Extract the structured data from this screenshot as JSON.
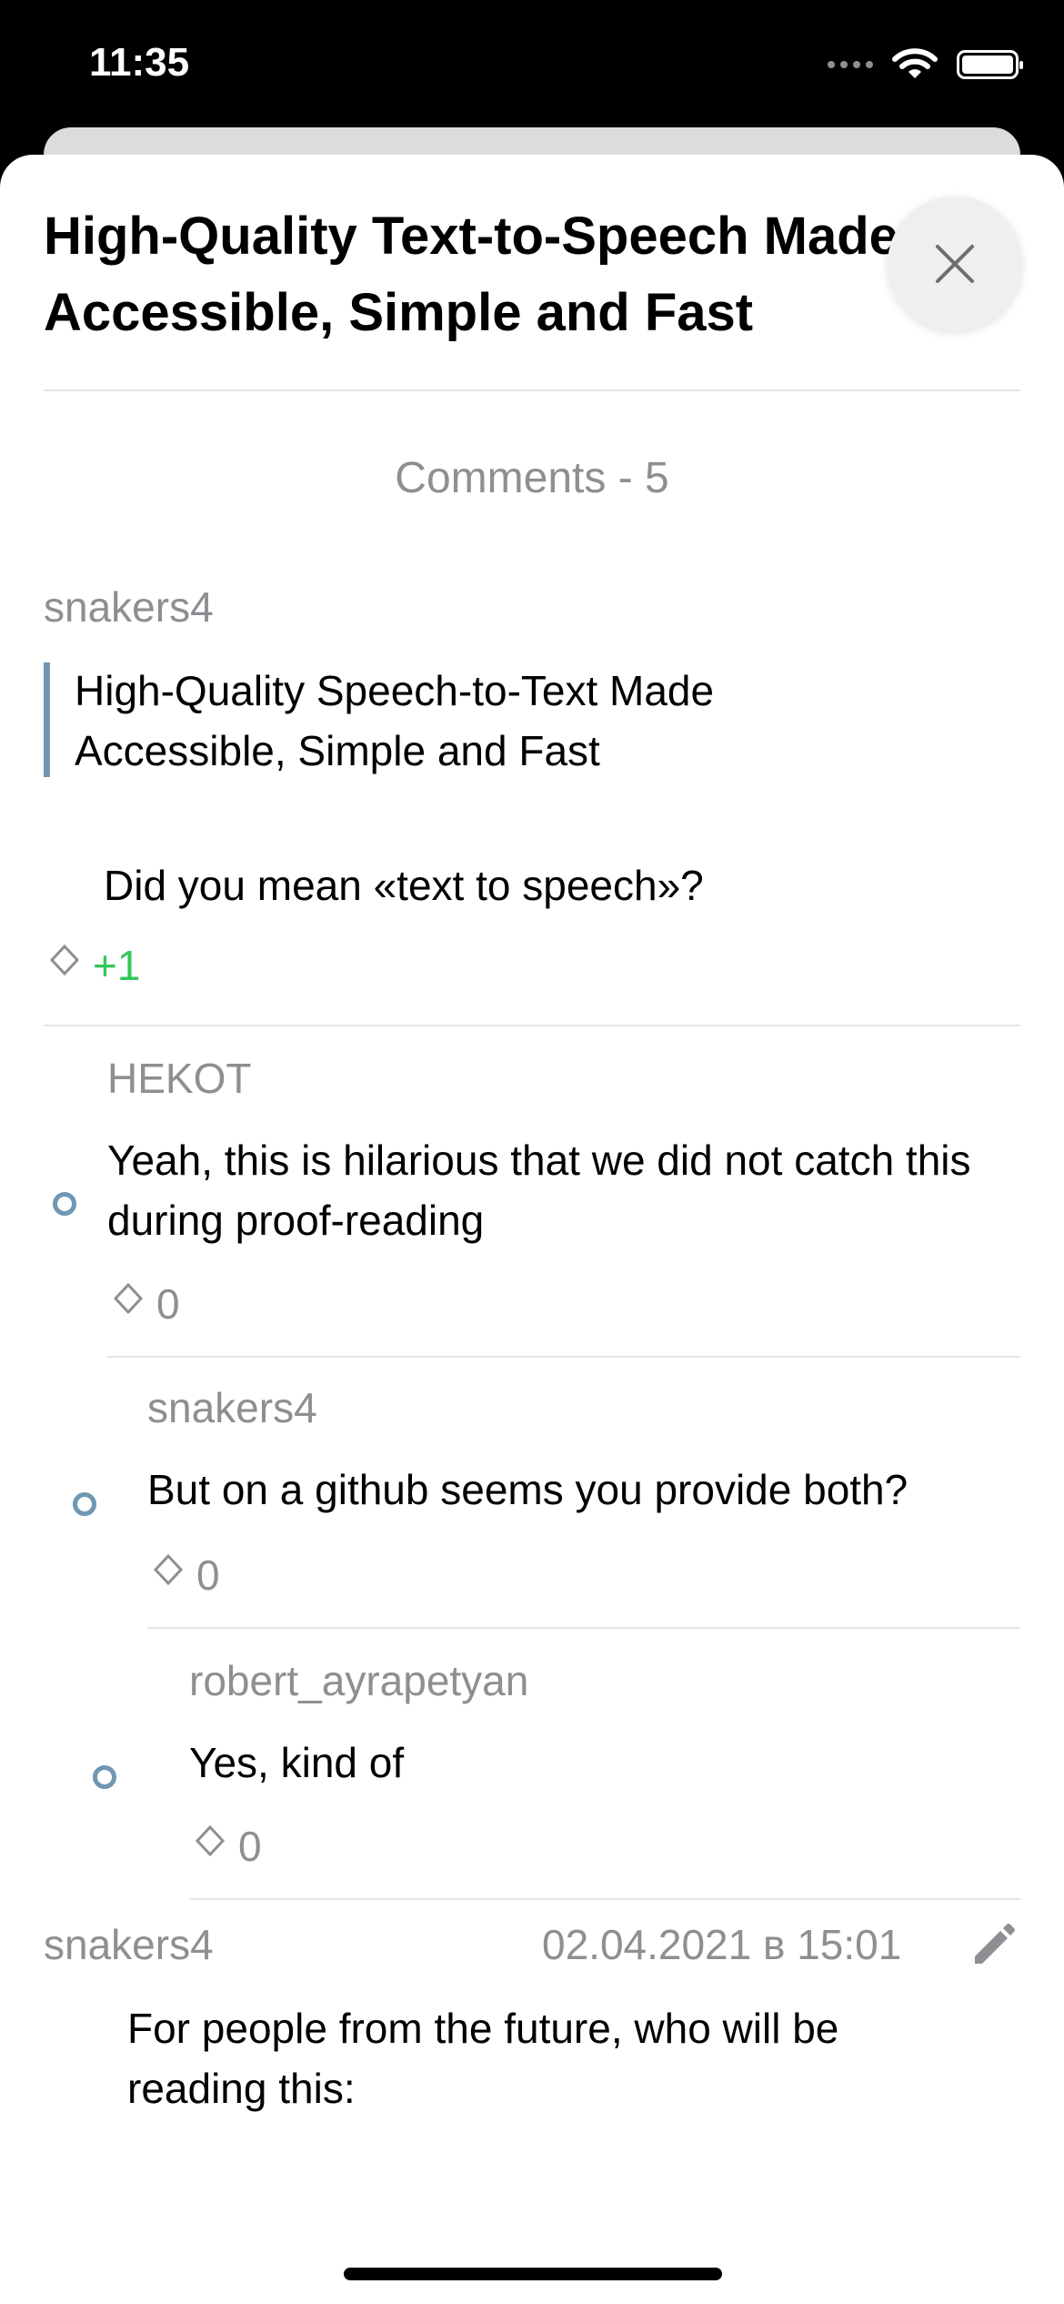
{
  "status_bar": {
    "time": "11:35"
  },
  "article": {
    "title": "High-Quality Text-to-Speech Made Accessible, Simple and Fast"
  },
  "comments": {
    "header": "Comments - 5",
    "items": [
      {
        "author": "snakers4",
        "quote": "High-Quality Speech-to-Text Made Accessible, Simple and Fast",
        "text": "Did you mean «text to speech»?",
        "score": "+1",
        "score_color": "#34c759"
      },
      {
        "author": "HEKOT",
        "text": "Yeah, this is hilarious that we did not catch this during proof-reading",
        "score": "0"
      },
      {
        "author": "snakers4",
        "text": "But on a github seems you provide both?",
        "score": "0"
      },
      {
        "author": "robert_ayrapetyan",
        "text": "Yes, kind of",
        "score": "0"
      },
      {
        "author": "snakers4",
        "date": "02.04.2021 в 15:01",
        "text": "For people from the future, who will be reading this:"
      }
    ]
  },
  "icons": {
    "close": "close-icon",
    "vote": "diamond-icon",
    "edit": "pencil-icon",
    "thread": "thread-dot-icon"
  },
  "colors": {
    "accent": "#6f97b4",
    "positive": "#34c759",
    "secondary_text": "#8e8e93"
  }
}
